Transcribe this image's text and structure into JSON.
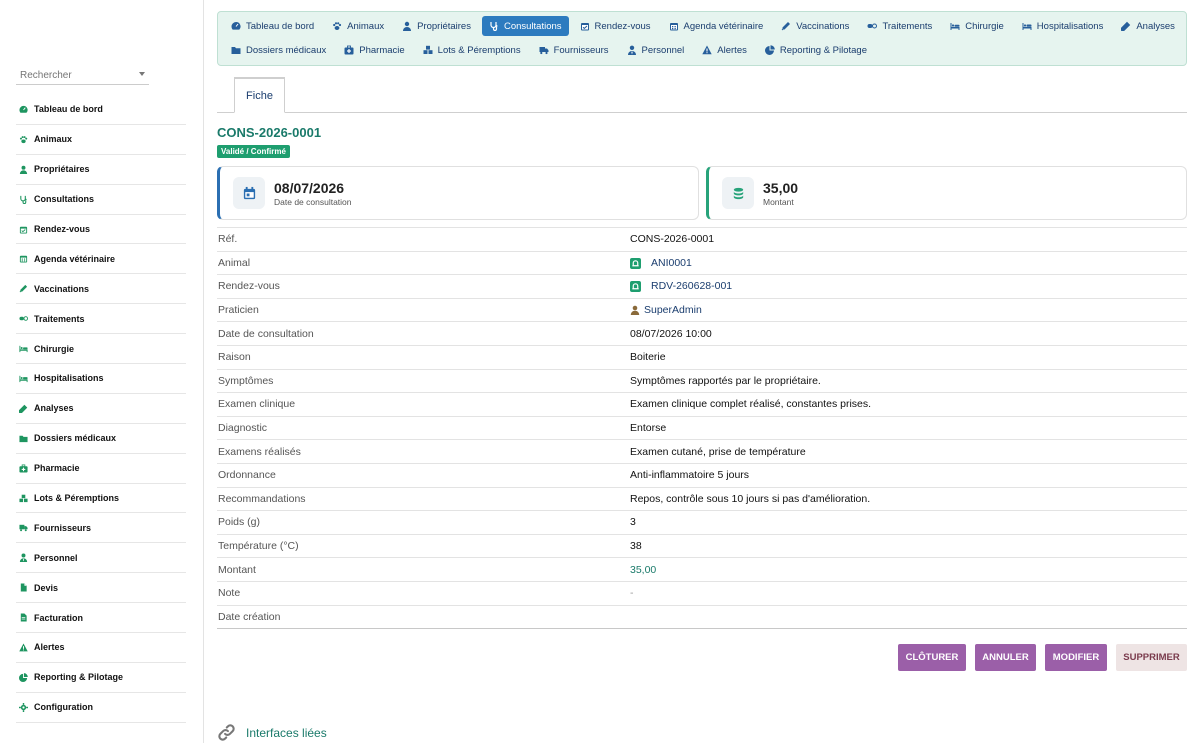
{
  "search": {
    "placeholder": "Rechercher"
  },
  "sidebar": {
    "items": [
      {
        "label": "Tableau de bord",
        "icon": "dashboard-icon"
      },
      {
        "label": "Animaux",
        "icon": "paw-icon"
      },
      {
        "label": "Propriétaires",
        "icon": "user-icon"
      },
      {
        "label": "Consultations",
        "icon": "stethoscope-icon"
      },
      {
        "label": "Rendez-vous",
        "icon": "calendar-check-icon"
      },
      {
        "label": "Agenda vétérinaire",
        "icon": "calendar-icon"
      },
      {
        "label": "Vaccinations",
        "icon": "syringe-icon"
      },
      {
        "label": "Traitements",
        "icon": "pills-icon"
      },
      {
        "label": "Chirurgie",
        "icon": "bed-icon"
      },
      {
        "label": "Hospitalisations",
        "icon": "hospital-bed-icon"
      },
      {
        "label": "Analyses",
        "icon": "test-tube-icon"
      },
      {
        "label": "Dossiers médicaux",
        "icon": "folder-icon"
      },
      {
        "label": "Pharmacie",
        "icon": "medkit-icon"
      },
      {
        "label": "Lots & Péremptions",
        "icon": "boxes-icon"
      },
      {
        "label": "Fournisseurs",
        "icon": "truck-icon"
      },
      {
        "label": "Personnel",
        "icon": "user-tie-icon"
      },
      {
        "label": "Devis",
        "icon": "file-icon"
      },
      {
        "label": "Facturation",
        "icon": "invoice-icon"
      },
      {
        "label": "Alertes",
        "icon": "warning-icon"
      },
      {
        "label": "Reporting & Pilotage",
        "icon": "pie-chart-icon"
      },
      {
        "label": "Configuration",
        "icon": "gear-icon"
      }
    ]
  },
  "topnav": {
    "row1": [
      {
        "label": "Tableau de bord",
        "icon": "dashboard-icon"
      },
      {
        "label": "Animaux",
        "icon": "paw-icon"
      },
      {
        "label": "Propriétaires",
        "icon": "user-icon"
      },
      {
        "label": "Consultations",
        "icon": "stethoscope-icon",
        "active": true
      },
      {
        "label": "Rendez-vous",
        "icon": "calendar-check-icon"
      },
      {
        "label": "Agenda vétérinaire",
        "icon": "calendar-icon"
      },
      {
        "label": "Vaccinations",
        "icon": "syringe-icon"
      },
      {
        "label": "Traitements",
        "icon": "pills-icon"
      },
      {
        "label": "Chirurgie",
        "icon": "bed-icon"
      },
      {
        "label": "Hospitalisations",
        "icon": "hospital-bed-icon"
      },
      {
        "label": "Analyses",
        "icon": "test-tube-icon"
      }
    ],
    "row2": [
      {
        "label": "Dossiers médicaux",
        "icon": "folder-icon"
      },
      {
        "label": "Pharmacie",
        "icon": "medkit-icon"
      },
      {
        "label": "Lots & Péremptions",
        "icon": "boxes-icon"
      },
      {
        "label": "Fournisseurs",
        "icon": "truck-icon"
      },
      {
        "label": "Personnel",
        "icon": "user-tie-icon"
      },
      {
        "label": "Alertes",
        "icon": "warning-icon"
      },
      {
        "label": "Reporting & Pilotage",
        "icon": "pie-chart-icon"
      }
    ]
  },
  "tabs": {
    "fiche": "Fiche"
  },
  "record": {
    "title": "CONS-2026-0001",
    "status": "Validé / Confirmé"
  },
  "cards": {
    "date": {
      "value": "08/07/2026",
      "label": "Date de consultation",
      "icon": "calendar-icon",
      "color": "#2b6fb2"
    },
    "amount": {
      "value": "35,00",
      "label": "Montant",
      "icon": "coins-icon",
      "color": "#27a37a"
    }
  },
  "details": [
    {
      "key": "Réf.",
      "value": "CONS-2026-0001"
    },
    {
      "key": "Animal",
      "value": "ANI0001",
      "type": "link"
    },
    {
      "key": "Rendez-vous",
      "value": "RDV-260628-001",
      "type": "link"
    },
    {
      "key": "Praticien",
      "value": "SuperAdmin",
      "type": "user"
    },
    {
      "key": "Date de consultation",
      "value": "08/07/2026 10:00"
    },
    {
      "key": "Raison",
      "value": "Boiterie"
    },
    {
      "key": "Symptômes",
      "value": "Symptômes rapportés par le propriétaire."
    },
    {
      "key": "Examen clinique",
      "value": "Examen clinique complet réalisé, constantes prises."
    },
    {
      "key": "Diagnostic",
      "value": "Entorse"
    },
    {
      "key": "Examens réalisés",
      "value": "Examen cutané, prise de température"
    },
    {
      "key": "Ordonnance",
      "value": "Anti-inflammatoire 5 jours"
    },
    {
      "key": "Recommandations",
      "value": "Repos, contrôle sous 10 jours si pas d'amélioration."
    },
    {
      "key": "Poids (g)",
      "value": "3"
    },
    {
      "key": "Température (°C)",
      "value": "38"
    },
    {
      "key": "Montant",
      "value": "35,00",
      "type": "amount"
    },
    {
      "key": "Note",
      "value": "-",
      "type": "muted"
    },
    {
      "key": "Date création",
      "value": ""
    }
  ],
  "actions": {
    "close": "CLÔTURER",
    "cancel": "ANNULER",
    "edit": "MODIFIER",
    "delete": "SUPPRIMER"
  },
  "linked": {
    "title": "Interfaces liées"
  },
  "colors": {
    "accent": "#1e9e6f",
    "active_nav": "#2d7bbf",
    "button": "#9b5fa8"
  }
}
